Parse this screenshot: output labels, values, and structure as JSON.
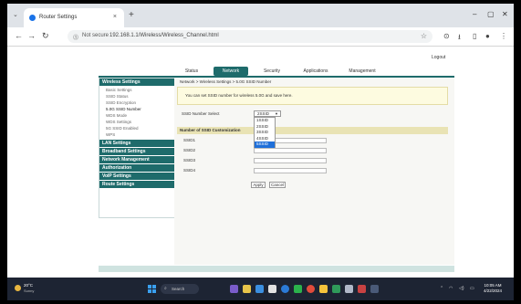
{
  "browser": {
    "tab_title": "Router Settings",
    "tab_close": "×",
    "new_tab": "+",
    "tab_list": "⌄",
    "minimize": "–",
    "maximize": "▢",
    "close": "✕",
    "back": "←",
    "forward": "→",
    "reload": "↻",
    "lock_glyph": "⓵",
    "security_label": "Not secure",
    "url": "192.168.1.1/Wireless/Wireless_Channel.html",
    "star": "☆",
    "ext1": "⊙",
    "ext2": "⭳",
    "ext3": "▯",
    "ext4": "●",
    "menu": "⋮"
  },
  "page": {
    "logout": "Logout",
    "nav": [
      "Status",
      "Network",
      "Security",
      "Applications",
      "Management"
    ],
    "active_nav": 1,
    "sidebar": {
      "sections": [
        {
          "label": "Wireless Settings",
          "items": [
            "Basic Settings",
            "SSID Status",
            "SSID Encryption",
            "5.0G SSID Number",
            "WDS Mode",
            "WDS Settings",
            "5G SSID Enabled",
            "WPS"
          ]
        },
        {
          "label": "LAN Settings",
          "items": []
        },
        {
          "label": "Broadband Settings",
          "items": []
        },
        {
          "label": "Network Management",
          "items": []
        },
        {
          "label": "Authorization",
          "items": []
        },
        {
          "label": "VoIP Settings",
          "items": []
        },
        {
          "label": "Route Settings",
          "items": []
        }
      ],
      "active_item": "5.0G SSID Number"
    },
    "breadcrumb": "Network > Wireless Settings > 5.0G SSID Number",
    "note": "You can set SSID number for wireless 5.0G and save here.",
    "ssid_number_label": "SSID Number Select",
    "ssid_number_value": "2SSID",
    "dropdown_options": [
      "1SSID",
      "2SSID",
      "3SSID",
      "4SSID",
      "5SSID"
    ],
    "highlighted_option": 4,
    "table_header": "Number of SSID Customization",
    "ssid_rows": [
      "SSID1",
      "SSID2",
      "SSID3",
      "SSID4"
    ],
    "apply_label": "Apply",
    "cancel_label": "Cancel"
  },
  "taskbar": {
    "weather_temp": "20°C",
    "weather_cond": "Sunny",
    "search_placeholder": "Search",
    "search_icon": "⌕",
    "tray_chevron": "⌃",
    "tray_wifi": "◠",
    "tray_volume": "◁)",
    "tray_battery": "▭",
    "time": "10:05 AM",
    "date": "4/22/2024"
  },
  "colors": {
    "router_accent": "#1e6b6b",
    "note_bg": "#fdfbe0",
    "highlight": "#1e6fd9",
    "taskbar_bg": "#1d2433"
  }
}
